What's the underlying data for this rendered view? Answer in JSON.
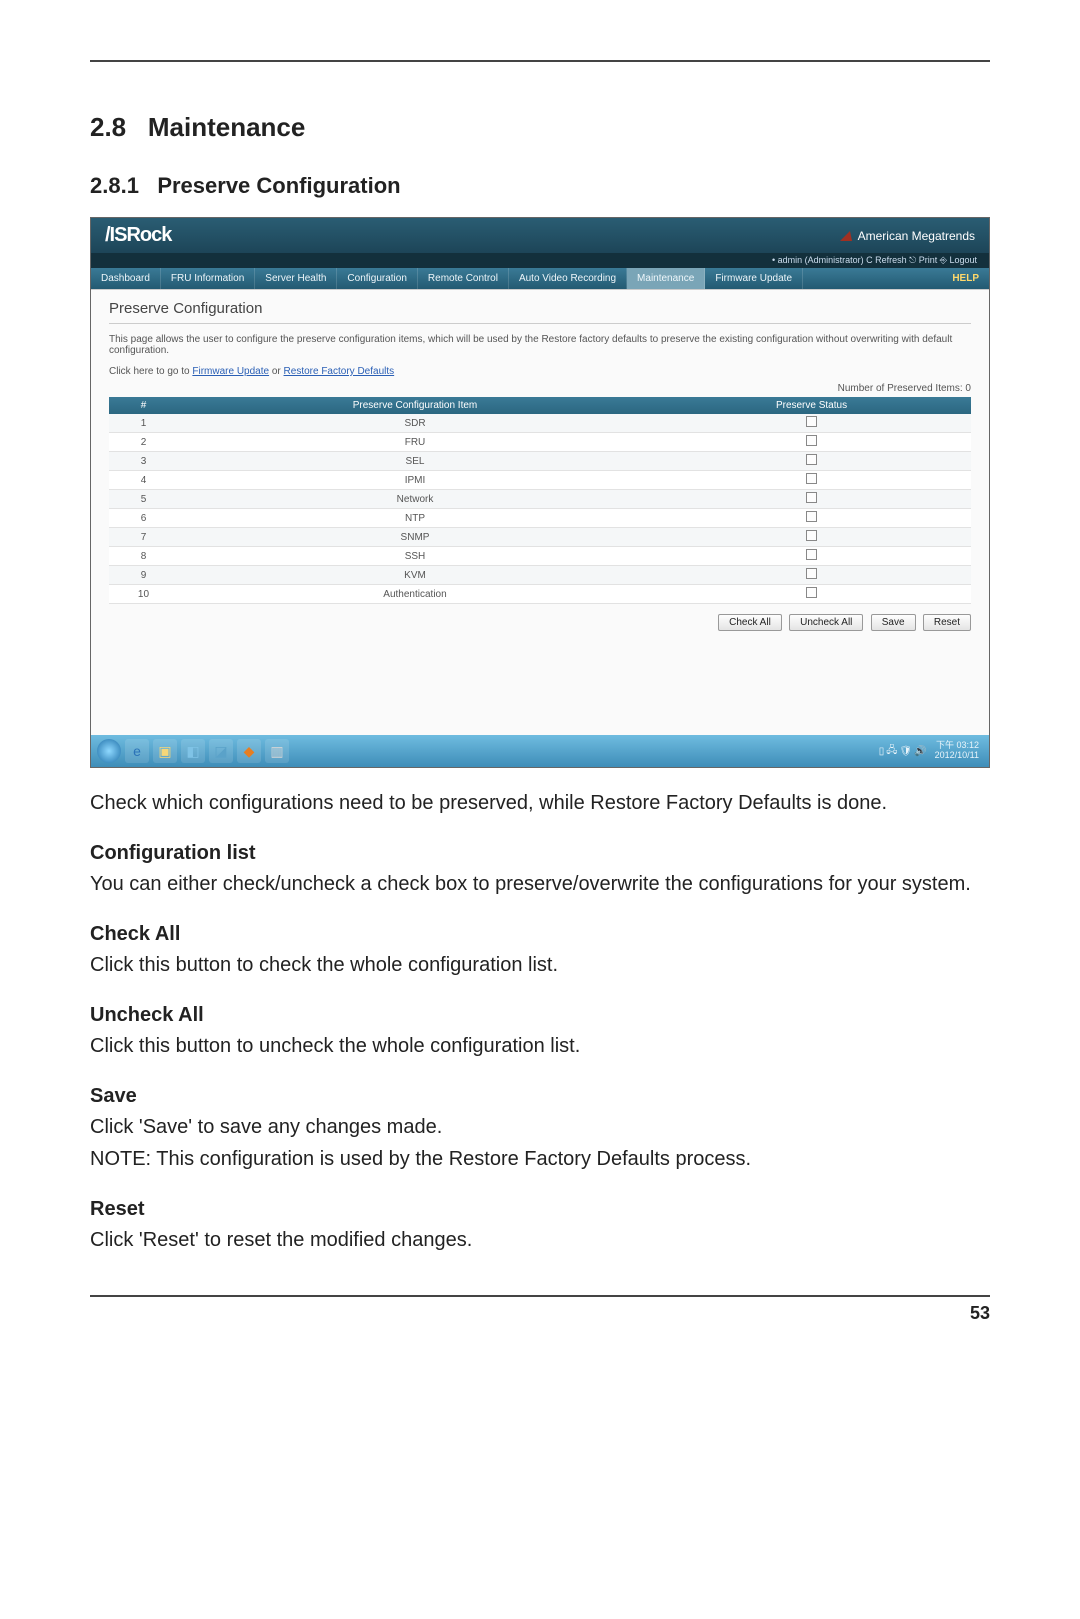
{
  "doc": {
    "section_number": "2.8",
    "section_title": "Maintenance",
    "subsection_number": "2.8.1",
    "subsection_title": "Preserve Configuration",
    "intro_paragraph": "Check which configurations need to be preserved, while Restore Factory Defaults is done.",
    "parts": {
      "config_list": {
        "heading": "Configuration list",
        "body": "You can either check/uncheck a check box to preserve/overwrite the configurations for your system."
      },
      "check_all": {
        "heading": "Check All",
        "body": "Click this button to check the whole configuration list."
      },
      "uncheck_all": {
        "heading": "Uncheck All",
        "body": "Click this button to uncheck the whole configuration list."
      },
      "save": {
        "heading": "Save",
        "body": "Click 'Save' to save any changes made.",
        "note": "NOTE: This configuration is used by the Restore Factory Defaults process."
      },
      "reset": {
        "heading": "Reset",
        "body": "Click 'Reset' to reset the modified changes."
      }
    },
    "page_number": "53"
  },
  "screenshot": {
    "brand_logo": "/ISRock",
    "ami_text": "American Megatrends",
    "topbar": "• admin (Administrator)   C Refresh   ⎋ Print   ⎆ Logout",
    "nav": {
      "items": [
        "Dashboard",
        "FRU Information",
        "Server Health",
        "Configuration",
        "Remote Control",
        "Auto Video Recording",
        "Maintenance",
        "Firmware Update"
      ],
      "help": "HELP"
    },
    "page_title": "Preserve Configuration",
    "description": "This page allows the user to configure the preserve configuration items, which will be used by the Restore factory defaults to preserve the existing configuration without overwriting with default configuration.",
    "links_prefix": "Click here to go to ",
    "link1": "Firmware Update",
    "links_sep": " or ",
    "link2": "Restore Factory Defaults",
    "count_label": "Number of Preserved Items: 0",
    "table": {
      "headers": [
        "#",
        "Preserve Configuration Item",
        "Preserve Status"
      ],
      "rows": [
        {
          "n": "1",
          "item": "SDR"
        },
        {
          "n": "2",
          "item": "FRU"
        },
        {
          "n": "3",
          "item": "SEL"
        },
        {
          "n": "4",
          "item": "IPMI"
        },
        {
          "n": "5",
          "item": "Network"
        },
        {
          "n": "6",
          "item": "NTP"
        },
        {
          "n": "7",
          "item": "SNMP"
        },
        {
          "n": "8",
          "item": "SSH"
        },
        {
          "n": "9",
          "item": "KVM"
        },
        {
          "n": "10",
          "item": "Authentication"
        }
      ]
    },
    "buttons": {
      "check_all": "Check All",
      "uncheck_all": "Uncheck All",
      "save": "Save",
      "reset": "Reset"
    },
    "taskbar": {
      "time": "下午 03:12",
      "date": "2012/10/11"
    }
  }
}
